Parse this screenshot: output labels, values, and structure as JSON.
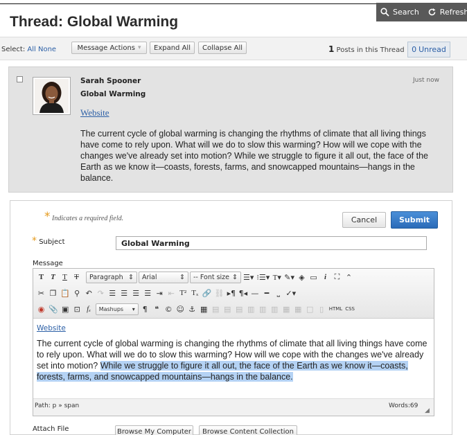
{
  "topbar": {
    "search_label": "Search",
    "refresh_label": "Refresh"
  },
  "page": {
    "title": "Thread: Global Warming"
  },
  "select": {
    "label": "Select:",
    "all": "All",
    "none": "None"
  },
  "toolbar": {
    "message_actions": "Message Actions",
    "expand_all": "Expand All",
    "collapse_all": "Collapse All",
    "posts_count": "1",
    "posts_label": "Posts in this Thread",
    "unread_count": "0",
    "unread_label": "Unread"
  },
  "post": {
    "author": "Sarah Spooner",
    "title": "Global Warming",
    "link": "Website",
    "time": "Just now",
    "body": "The current cycle of global warming is changing the rhythms of climate that all living things have come to rely upon. What will we do to slow this warming? How will we cope with the changes we've already set into motion? While we struggle to figure it all out, the face of the Earth as we know it—coasts, forests, farms, and snowcapped mountains—hangs in the balance."
  },
  "reply": {
    "required_note": "Indicates a required field.",
    "cancel": "Cancel",
    "submit": "Submit",
    "subject_label": "Subject",
    "subject_value": "Global Warming",
    "message_label": "Message",
    "editor": {
      "paragraph": "Paragraph",
      "font": "Arial",
      "font_size": "-- Font size",
      "mashups": "Mashups",
      "link": "Website",
      "body_plain": "The current cycle of global warming is changing the rhythms of climate that all living things have come to rely upon. What will we do to slow this warming? How will we cope with the changes we've already set into motion? ",
      "body_selected": "While we struggle to figure it all out, the face of the Earth as we know it—coasts, forests, farms, and snowcapped mountains—hangs in the balance.",
      "path": "Path: p » span",
      "words": "Words:69"
    },
    "attach_label": "Attach File",
    "browse_computer": "Browse My Computer",
    "browse_collection": "Browse Content Collection"
  },
  "colors": {
    "accent": "#2a6bb8",
    "link": "#2b5fa6",
    "required": "#e59a1c",
    "selection": "#b4d2f4"
  }
}
